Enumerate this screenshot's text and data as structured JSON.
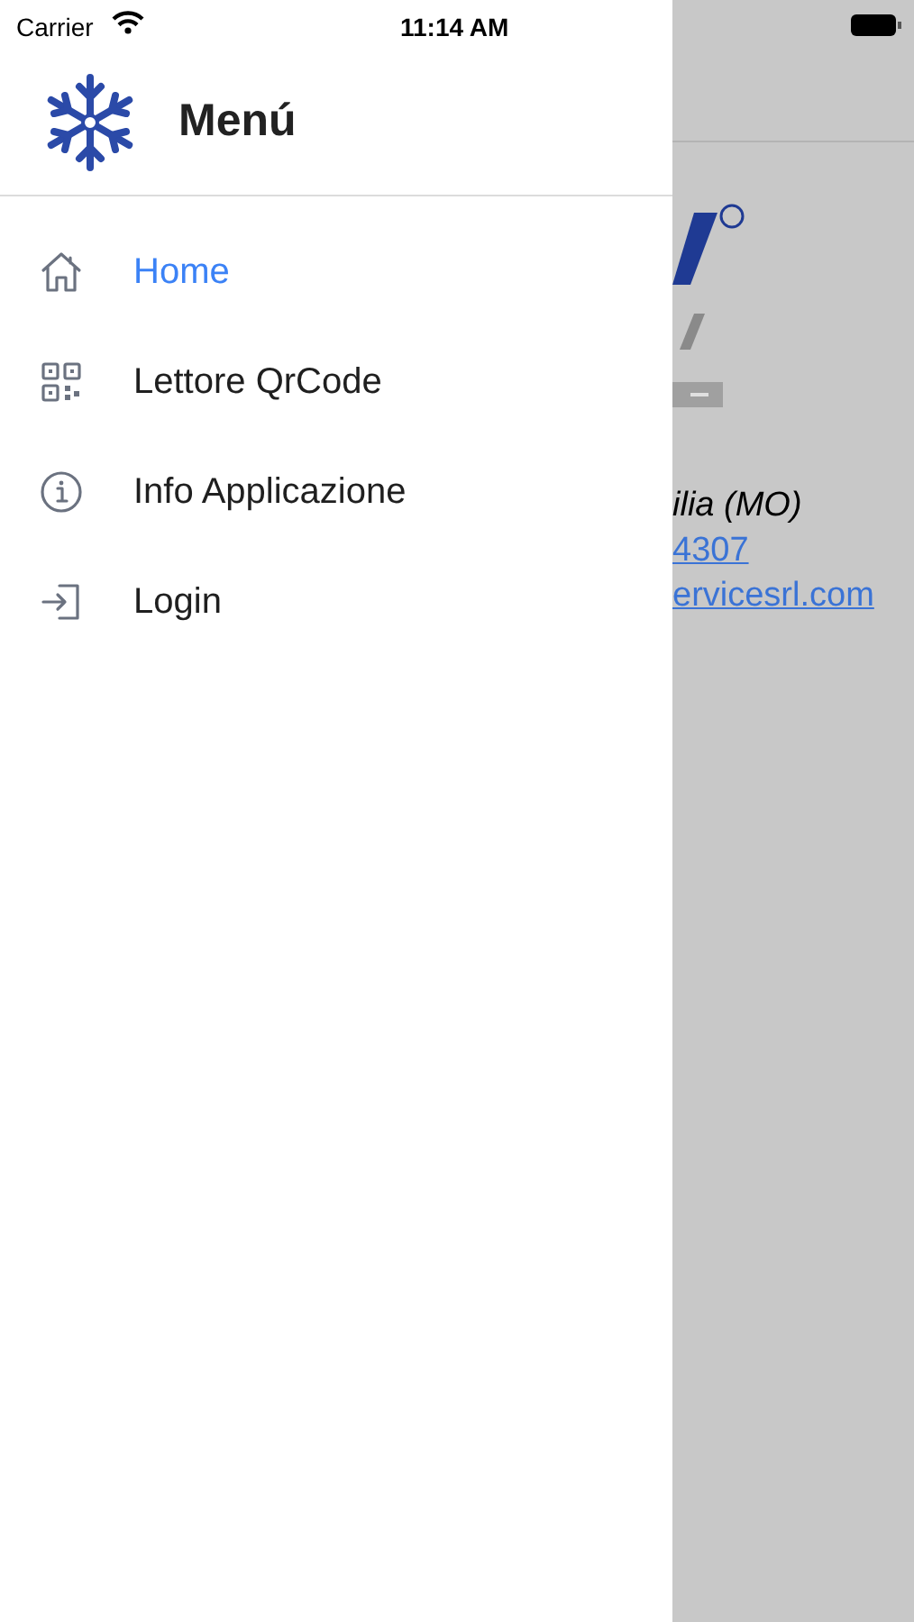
{
  "status_bar": {
    "carrier": "Carrier",
    "time": "11:14 AM"
  },
  "drawer": {
    "title": "Menú",
    "items": [
      {
        "label": "Home",
        "kind": "home",
        "selected": true
      },
      {
        "label": "Lettore QrCode",
        "kind": "qr",
        "selected": false
      },
      {
        "label": "Info Applicazione",
        "kind": "info",
        "selected": false
      },
      {
        "label": "Login",
        "kind": "login",
        "selected": false
      }
    ]
  },
  "background_page": {
    "address": "ilia (MO)",
    "phone": "4307",
    "email": "ervicesrl.com"
  }
}
